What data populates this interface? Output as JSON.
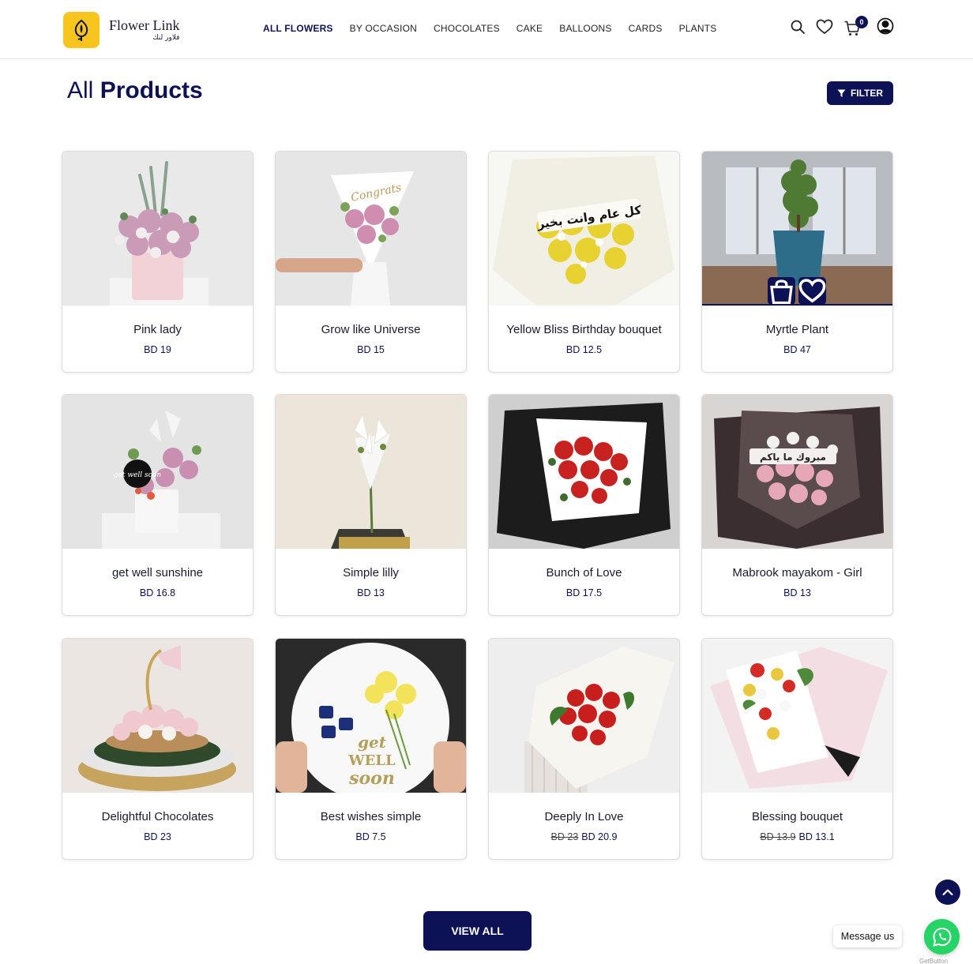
{
  "brand": {
    "name_en": "Flower Link",
    "name_ar": "فلاور لنك"
  },
  "nav": [
    {
      "label": "ALL FLOWERS",
      "active": true
    },
    {
      "label": "BY OCCASION",
      "active": false
    },
    {
      "label": "CHOCOLATES",
      "active": false
    },
    {
      "label": "CAKE",
      "active": false
    },
    {
      "label": "BALLOONS",
      "active": false
    },
    {
      "label": "CARDS",
      "active": false
    },
    {
      "label": "PLANTS",
      "active": false
    }
  ],
  "header_icons": {
    "search": "search-icon",
    "wishlist": "heart-icon",
    "cart": "cart-icon",
    "account": "user-icon",
    "cart_count": "0"
  },
  "page": {
    "title_light": "All",
    "title_bold": "Products",
    "filter_label": "FILTER"
  },
  "products": [
    {
      "name": "Pink lady",
      "price": "BD 19",
      "old_price": ""
    },
    {
      "name": "Grow like Universe",
      "price": "BD 15",
      "old_price": ""
    },
    {
      "name": "Yellow Bliss Birthday bouquet",
      "price": "BD 12.5",
      "old_price": ""
    },
    {
      "name": "Myrtle Plant",
      "price": "BD 47",
      "old_price": ""
    },
    {
      "name": "get well sunshine",
      "price": "BD 16.8",
      "old_price": ""
    },
    {
      "name": "Simple lilly",
      "price": "BD 13",
      "old_price": ""
    },
    {
      "name": "Bunch of Love",
      "price": "BD 17.5",
      "old_price": ""
    },
    {
      "name": "Mabrook mayakom - Girl",
      "price": "BD 13",
      "old_price": ""
    },
    {
      "name": "Delightful Chocolates",
      "price": "BD 23",
      "old_price": ""
    },
    {
      "name": "Best wishes simple",
      "price": "BD 7.5",
      "old_price": ""
    },
    {
      "name": "Deeply In Love",
      "price": "BD 20.9",
      "old_price": "BD 23"
    },
    {
      "name": "Blessing bouquet",
      "price": "BD 13.1",
      "old_price": "BD 13.9"
    }
  ],
  "image_text": {
    "congrats": "Congrats",
    "yellow_card": "كل عام وانت بخير",
    "getwell_pick": "get well soon",
    "mabrook_card": "مبروك ما ياكم",
    "getwell_box": [
      "get",
      "WELL",
      "soon"
    ]
  },
  "hover_actions": {
    "cart": "bag-icon",
    "wish": "heart-icon"
  },
  "footer": {
    "view_all": "VIEW ALL",
    "message_us": "Message us",
    "getbutton": "GetButton"
  },
  "colors": {
    "primary": "#0c1255",
    "logo_yellow": "#f7c51e",
    "whatsapp": "#25d366"
  }
}
